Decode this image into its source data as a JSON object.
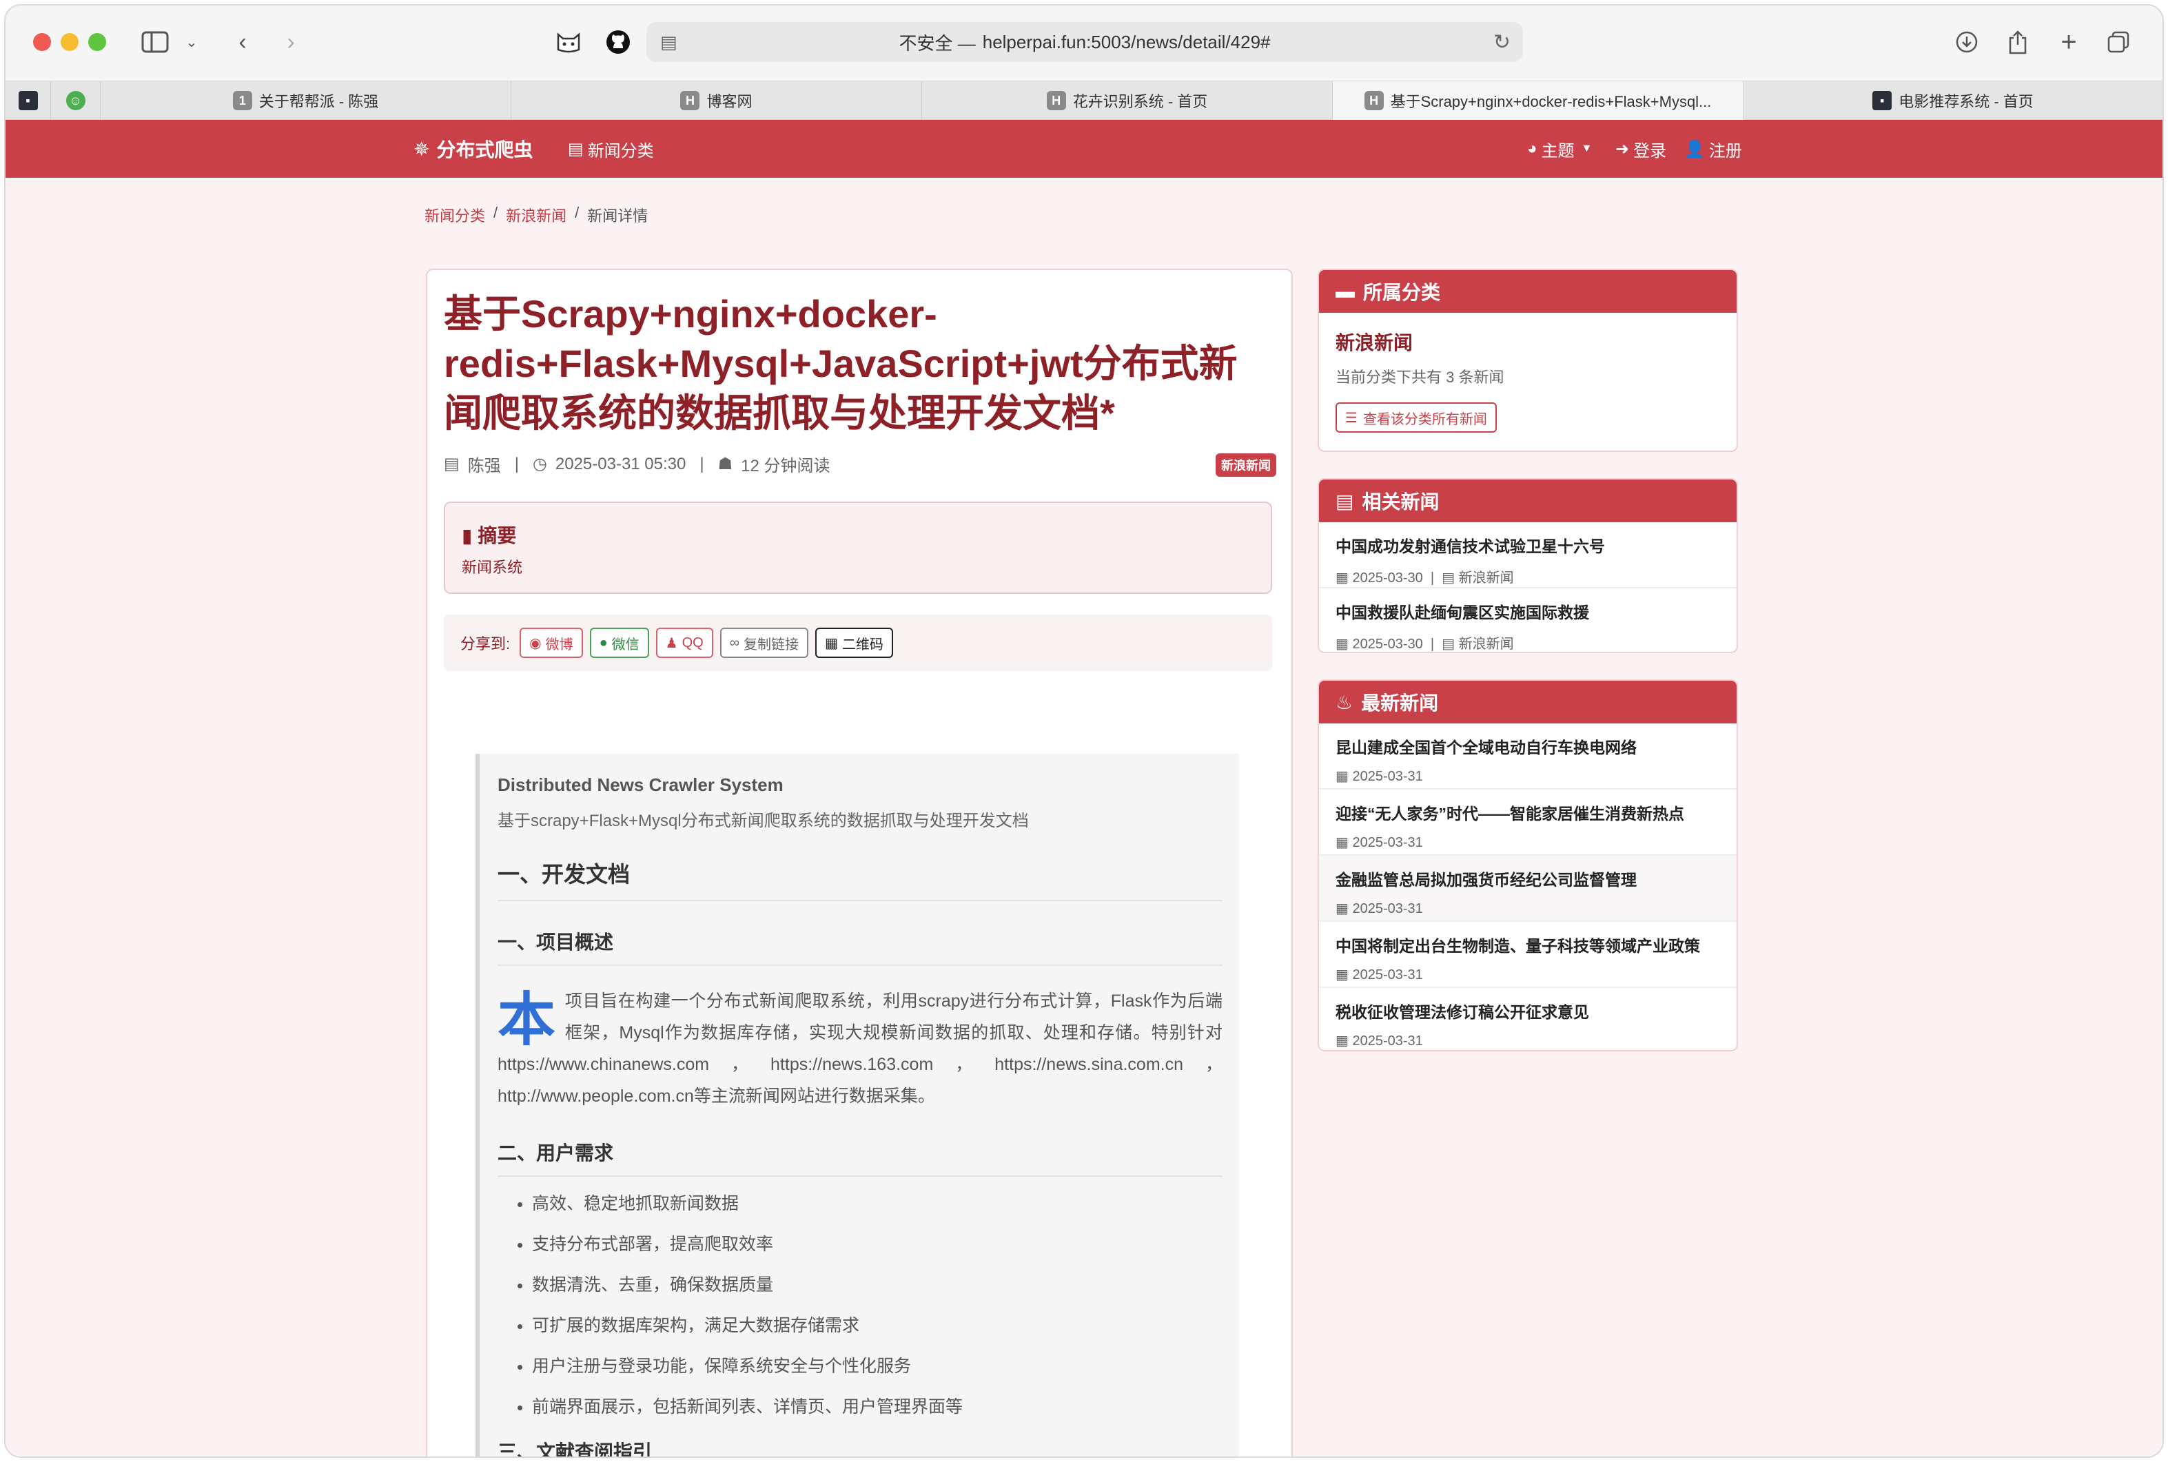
{
  "browser": {
    "address_prefix": "不安全 —",
    "address_url": "helperpai.fun:5003/news/detail/429#",
    "tabs": [
      {
        "label": "关于帮帮派 - 陈强",
        "fav": "1"
      },
      {
        "label": "博客网",
        "fav": "H"
      },
      {
        "label": "花卉识别系统 - 首页",
        "fav": "H"
      },
      {
        "label": "基于Scrapy+nginx+docker-redis+Flask+Mysql...",
        "fav": "H"
      },
      {
        "label": "电影推荐系统 - 首页",
        "fav": ""
      }
    ]
  },
  "navbar": {
    "brand": "分布式爬虫",
    "news_category": "新闻分类",
    "theme": "主题",
    "login": "登录",
    "register": "注册"
  },
  "breadcrumb": {
    "item1": "新闻分类",
    "item2": "新浪新闻",
    "item3": "新闻详情"
  },
  "article": {
    "title": "基于Scrapy+nginx+docker-redis+Flask+Mysql+JavaScript+jwt分布式新闻爬取系统的数据抓取与处理开发文档*",
    "author": "陈强",
    "datetime": "2025-03-31 05:30",
    "read_time": "12 分钟阅读",
    "category_badge": "新浪新闻",
    "summary_heading": "摘要",
    "summary_text": "新闻系统",
    "share_label": "分享到:",
    "share_weibo": "微博",
    "share_wechat": "微信",
    "share_qq": "QQ",
    "share_copy": "复制链接",
    "share_qrcode": "二维码"
  },
  "content": {
    "heading_en": "Distributed News Crawler System",
    "subtitle": "基于scrapy+Flask+Mysql分布式新闻爬取系统的数据抓取与处理开发文档",
    "h_dev_doc": "一、开发文档",
    "h_overview": "一、项目概述",
    "drop_cap": "本",
    "overview_text": "项目旨在构建一个分布式新闻爬取系统，利用scrapy进行分布式计算，Flask作为后端框架，Mysql作为数据库存储，实现大规模新闻数据的抓取、处理和存储。特别针对https://www.chinanews.com，https://news.163.com，https://news.sina.com.cn，http://www.people.com.cn等主流新闻网站进行数据采集。",
    "h_requirements": "二、用户需求",
    "requirements": [
      "高效、稳定地抓取新闻数据",
      "支持分布式部署，提高爬取效率",
      "数据清洗、去重，确保数据质量",
      "可扩展的数据库架构，满足大数据存储需求",
      "用户注册与登录功能，保障系统安全与个性化服务",
      "前端界面展示，包括新闻列表、详情页、用户管理界面等"
    ],
    "h_references": "三、文献查阅指引"
  },
  "sidebar": {
    "category_card": {
      "title": "所属分类",
      "name": "新浪新闻",
      "count_text": "当前分类下共有 3 条新闻",
      "button": "查看该分类所有新闻"
    },
    "related_card": {
      "title": "相关新闻",
      "items": [
        {
          "title": "中国成功发射通信技术试验卫星十六号",
          "date": "2025-03-30",
          "cat": "新浪新闻"
        },
        {
          "title": "中国救援队赴缅甸震区实施国际救援",
          "date": "2025-03-30",
          "cat": "新浪新闻"
        }
      ]
    },
    "latest_card": {
      "title": "最新新闻",
      "items": [
        {
          "title": "昆山建成全国首个全域电动自行车换电网络",
          "date": "2025-03-31"
        },
        {
          "title": "迎接“无人家务”时代——智能家居催生消费新热点",
          "date": "2025-03-31"
        },
        {
          "title": "金融监管总局拟加强货币经纪公司监督管理",
          "date": "2025-03-31"
        },
        {
          "title": "中国将制定出台生物制造、量子科技等领域产业政策",
          "date": "2025-03-31"
        },
        {
          "title": "税收征收管理法修订稿公开征求意见",
          "date": "2025-03-31"
        }
      ]
    }
  },
  "colors": {
    "primary": "#c94048",
    "title": "#8e2128",
    "page_bg": "#fdf2f3",
    "drop_cap": "#2f6fd6"
  }
}
